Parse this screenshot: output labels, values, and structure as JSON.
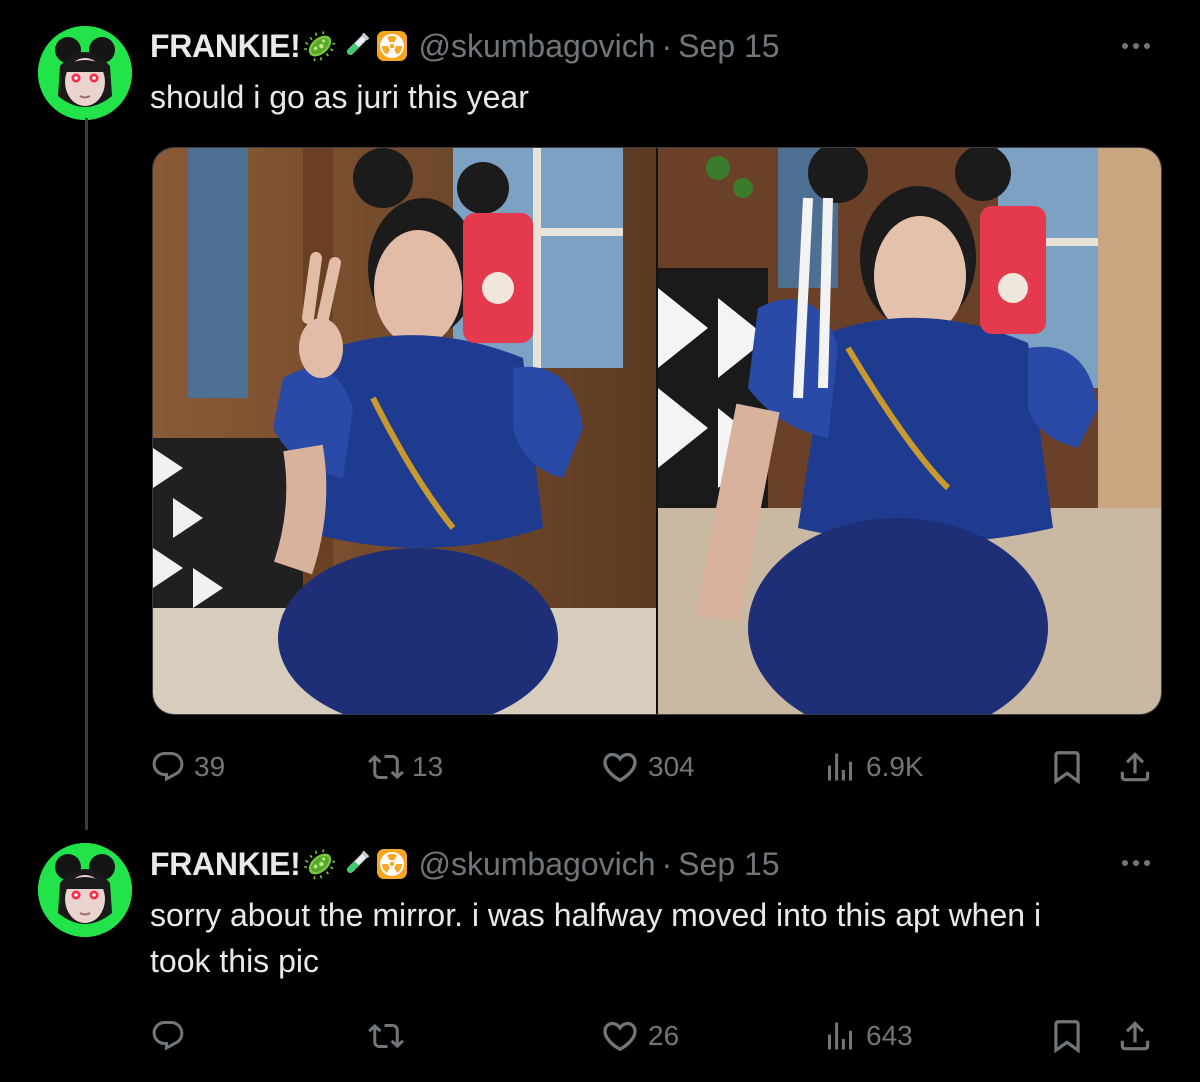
{
  "thread": [
    {
      "author": {
        "display_name": "FRANKIE!",
        "name_emojis": [
          "microbe-emoji",
          "test-tube-emoji",
          "radioactive-emoji"
        ],
        "handle": "@skumbagovich",
        "separator": "·",
        "date": "Sep 15"
      },
      "text": "should i go as juri this year",
      "media": [
        "photo-1",
        "photo-2"
      ],
      "stats": {
        "replies": "39",
        "reposts": "13",
        "likes": "304",
        "views": "6.9K"
      }
    },
    {
      "author": {
        "display_name": "FRANKIE!",
        "name_emojis": [
          "microbe-emoji",
          "test-tube-emoji",
          "radioactive-emoji"
        ],
        "handle": "@skumbagovich",
        "separator": "·",
        "date": "Sep 15"
      },
      "text": "sorry about the mirror. i was halfway moved into this apt when i took this pic",
      "stats": {
        "replies": "",
        "reposts": "",
        "likes": "26",
        "views": "643"
      }
    }
  ],
  "colors": {
    "background": "#000000",
    "text_primary": "#e7e9ea",
    "text_secondary": "#71767b",
    "avatar_bg": "#22e34a",
    "thread_line": "#3a3d41"
  },
  "icons": [
    "reply-icon",
    "repost-icon",
    "like-icon",
    "views-icon",
    "bookmark-icon",
    "share-icon",
    "more-icon"
  ]
}
